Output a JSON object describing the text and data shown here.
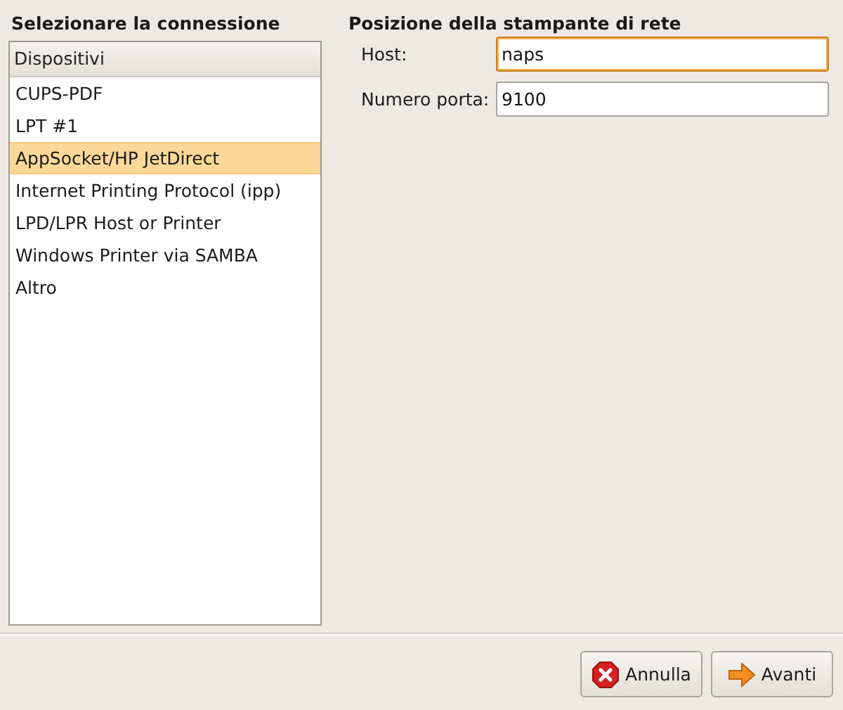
{
  "connection_heading": "Selezionare la connessione",
  "devices": {
    "column": "Dispositivi",
    "items": [
      {
        "label": "CUPS-PDF",
        "selected": false
      },
      {
        "label": "LPT #1",
        "selected": false
      },
      {
        "label": "AppSocket/HP JetDirect",
        "selected": true
      },
      {
        "label": "Internet Printing Protocol (ipp)",
        "selected": false
      },
      {
        "label": "LPD/LPR Host or Printer",
        "selected": false
      },
      {
        "label": "Windows Printer via SAMBA",
        "selected": false
      },
      {
        "label": "Altro",
        "selected": false
      }
    ]
  },
  "location_heading": "Posizione della stampante di rete",
  "fields": [
    {
      "label": "Host:",
      "value": "naps",
      "focused": true
    },
    {
      "label": "Numero porta:",
      "value": "9100",
      "focused": false
    }
  ],
  "buttons": [
    {
      "kind": "cancel",
      "label": "Annulla"
    },
    {
      "kind": "forward",
      "label": "Avanti"
    }
  ]
}
